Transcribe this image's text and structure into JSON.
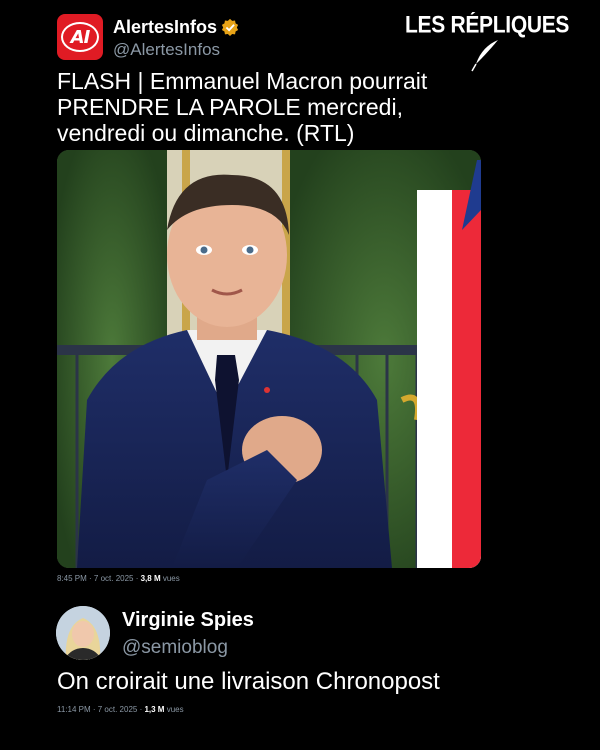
{
  "brand": {
    "title": "LES RÉPLIQUES"
  },
  "tweet1": {
    "logo_text": "AI",
    "name": "AlertesInfos",
    "verified_icon": "verified-badge-icon",
    "handle": "@AlertesInfos",
    "text": "FLASH | Emmanuel Macron pourrait PRENDRE LA PAROLE mercredi, vendredi ou dimanche. (RTL)",
    "time": "8:45 PM · 7 oct. 2025 · ",
    "views": "3,8 M",
    "views_label": " vues"
  },
  "tweet2": {
    "name": "Virginie Spies",
    "handle": "@semioblog",
    "text": "On croirait une livraison Chronopost",
    "time": "11:14 PM · 7 oct. 2025 · ",
    "views": "1,3 M",
    "views_label": " vues"
  },
  "colors": {
    "background": "#000000",
    "logo_red": "#e01b24",
    "badge_gold": "#e8a317",
    "muted_text": "#8b98a5"
  }
}
